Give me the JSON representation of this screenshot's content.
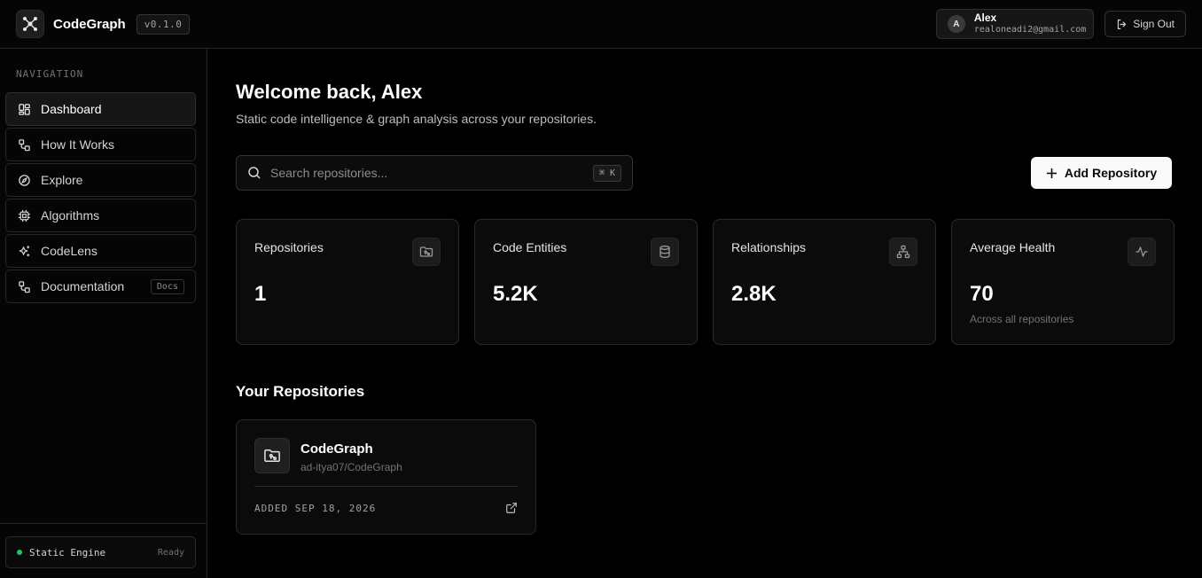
{
  "header": {
    "brand": "CodeGraph",
    "version": "v0.1.0",
    "user": {
      "initial": "A",
      "name": "Alex",
      "email": "realoneadi2@gmail.com"
    },
    "signout_label": "Sign Out"
  },
  "sidebar": {
    "title": "NAVIGATION",
    "items": [
      {
        "label": "Dashboard",
        "icon": "dashboard-icon"
      },
      {
        "label": "How It Works",
        "icon": "workflow-icon"
      },
      {
        "label": "Explore",
        "icon": "compass-icon"
      },
      {
        "label": "Algorithms",
        "icon": "cpu-icon"
      },
      {
        "label": "CodeLens",
        "icon": "sparkles-icon"
      },
      {
        "label": "Documentation",
        "icon": "workflow-icon",
        "badge": "Docs"
      }
    ],
    "footer": {
      "engine_label": "Static Engine",
      "status": "Ready"
    }
  },
  "main": {
    "welcome": "Welcome back, Alex",
    "subtitle": "Static code intelligence & graph analysis across your repositories.",
    "search": {
      "placeholder": "Search repositories...",
      "shortcut": "⌘ K"
    },
    "add_label": "Add Repository",
    "stats": [
      {
        "label": "Repositories",
        "value": "1",
        "icon": "folder-git-icon"
      },
      {
        "label": "Code Entities",
        "value": "5.2K",
        "icon": "database-icon"
      },
      {
        "label": "Relationships",
        "value": "2.8K",
        "icon": "network-icon"
      },
      {
        "label": "Average Health",
        "value": "70",
        "sub": "Across all repositories",
        "icon": "activity-icon"
      }
    ],
    "section_title": "Your Repositories",
    "repo": {
      "name": "CodeGraph",
      "path": "ad-itya07/CodeGraph",
      "added": "ADDED SEP 18, 2026"
    }
  },
  "colors": {
    "accent": "#fafafa",
    "status_ready": "#22c55e",
    "background": "#000000"
  }
}
